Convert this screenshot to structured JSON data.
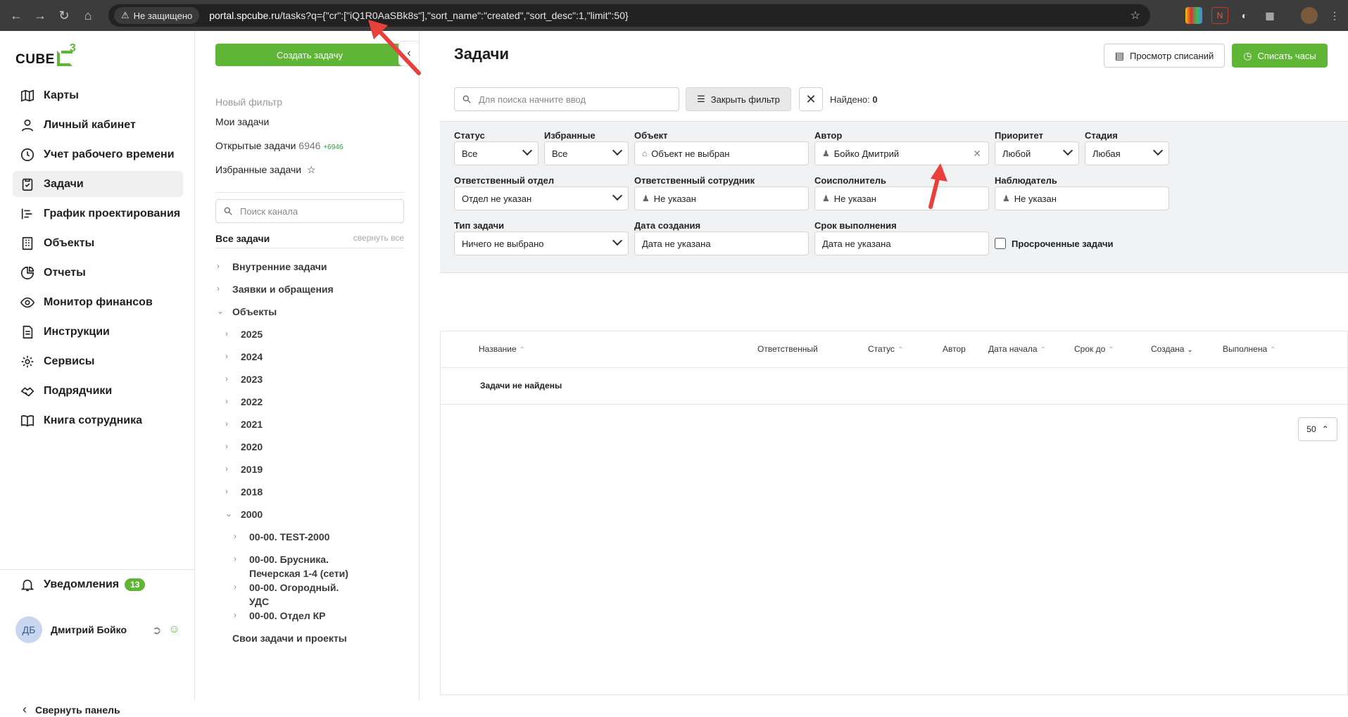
{
  "browser": {
    "security_label": "Не защищено",
    "url_host": "portal.spcube.ru",
    "url_path": "/tasks?q={\"cr\":[\"iQ1R0AaSBk8s\"],\"sort_name\":\"created\",\"sort_desc\":1,\"limit\":50}"
  },
  "logo": {
    "text": "CUBE",
    "sup": "3"
  },
  "sidebar": {
    "items": [
      {
        "label": "Карты",
        "icon": "map-icon"
      },
      {
        "label": "Личный кабинет",
        "icon": "user-icon"
      },
      {
        "label": "Учет рабочего времени",
        "icon": "clock-icon"
      },
      {
        "label": "Задачи",
        "icon": "clipboard-check-icon",
        "active": true
      },
      {
        "label": "График проектирования",
        "icon": "gantt-icon"
      },
      {
        "label": "Объекты",
        "icon": "building-icon"
      },
      {
        "label": "Отчеты",
        "icon": "pie-chart-icon"
      },
      {
        "label": "Монитор финансов",
        "icon": "eye-icon"
      },
      {
        "label": "Инструкции",
        "icon": "document-icon"
      },
      {
        "label": "Сервисы",
        "icon": "gear-icon"
      },
      {
        "label": "Подрядчики",
        "icon": "handshake-icon"
      },
      {
        "label": "Книга сотрудника",
        "icon": "book-icon"
      }
    ],
    "notifications_label": "Уведомления",
    "notifications_count": "13",
    "user_initials": "ДБ",
    "user_name": "Дмитрий Бойко",
    "collapse_label": "Свернуть панель"
  },
  "panel": {
    "create_button": "Создать задачу",
    "new_filter": "Новый фильтр",
    "my_tasks": "Мои задачи",
    "open_tasks": "Открытые задачи",
    "open_tasks_count": "6946",
    "open_tasks_delta": "+6946",
    "favorite_tasks": "Избранные задачи",
    "channel_search_placeholder": "Поиск канала",
    "all_tasks": "Все задачи",
    "collapse_all": "свернуть все",
    "tree": [
      {
        "label": "Внутренние задачи",
        "level": 0,
        "open": false
      },
      {
        "label": "Заявки и обращения",
        "level": 0,
        "open": false
      },
      {
        "label": "Объекты",
        "level": 0,
        "open": true
      },
      {
        "label": "2025",
        "level": 1,
        "open": false
      },
      {
        "label": "2024",
        "level": 1,
        "open": false
      },
      {
        "label": "2023",
        "level": 1,
        "open": false
      },
      {
        "label": "2022",
        "level": 1,
        "open": false
      },
      {
        "label": "2021",
        "level": 1,
        "open": false
      },
      {
        "label": "2020",
        "level": 1,
        "open": false
      },
      {
        "label": "2019",
        "level": 1,
        "open": false
      },
      {
        "label": "2018",
        "level": 1,
        "open": false
      },
      {
        "label": "2000",
        "level": 1,
        "open": true
      },
      {
        "label": "00-00. TEST-2000",
        "level": 2,
        "open": false
      },
      {
        "label": "00-00. Брусника. Печерская 1-4 (сети)",
        "level": 2,
        "open": false
      },
      {
        "label": "00-00. Огородный. УДС",
        "level": 2,
        "open": false
      },
      {
        "label": "00-00. Отдел КР",
        "level": 2,
        "open": false
      },
      {
        "label": "Свои задачи и проекты",
        "level": 0,
        "open": null
      }
    ]
  },
  "main": {
    "title": "Задачи",
    "view_writeoffs": "Просмотр списаний",
    "writeoff_hours": "Списать часы",
    "search_placeholder": "Для поиска начните ввод",
    "close_filter": "Закрыть фильтр",
    "found_label": "Найдено:",
    "found_count": "0",
    "filters": {
      "status": {
        "label": "Статус",
        "value": "Все"
      },
      "favorites": {
        "label": "Избранные",
        "value": "Все"
      },
      "object": {
        "label": "Объект",
        "value": "Объект не выбран"
      },
      "author": {
        "label": "Автор",
        "value": "Бойко Дмитрий"
      },
      "priority": {
        "label": "Приоритет",
        "value": "Любой"
      },
      "stage": {
        "label": "Стадия",
        "value": "Любая"
      },
      "resp_dept": {
        "label": "Ответственный отдел",
        "value": "Отдел не указан"
      },
      "resp_employee": {
        "label": "Ответственный сотрудник",
        "value": "Не указан"
      },
      "coexecutor": {
        "label": "Соисполнитель",
        "value": "Не указан"
      },
      "observer": {
        "label": "Наблюдатель",
        "value": "Не указан"
      },
      "task_type": {
        "label": "Тип задачи",
        "value": "Ничего не выбрано"
      },
      "created_date": {
        "label": "Дата создания",
        "value": "Дата не указана"
      },
      "due_date": {
        "label": "Срок выполнения",
        "value": "Дата не указана"
      },
      "overdue": {
        "label": "Просроченные задачи",
        "checked": false
      }
    },
    "table": {
      "columns": [
        "Название",
        "Ответственный",
        "Статус",
        "Автор",
        "Дата начала",
        "Срок до",
        "Создана",
        "Выполнена"
      ],
      "empty_text": "Задачи не найдены",
      "page_size": "50"
    }
  },
  "colors": {
    "accent": "#5fb536",
    "annotation": "#e8413b"
  }
}
